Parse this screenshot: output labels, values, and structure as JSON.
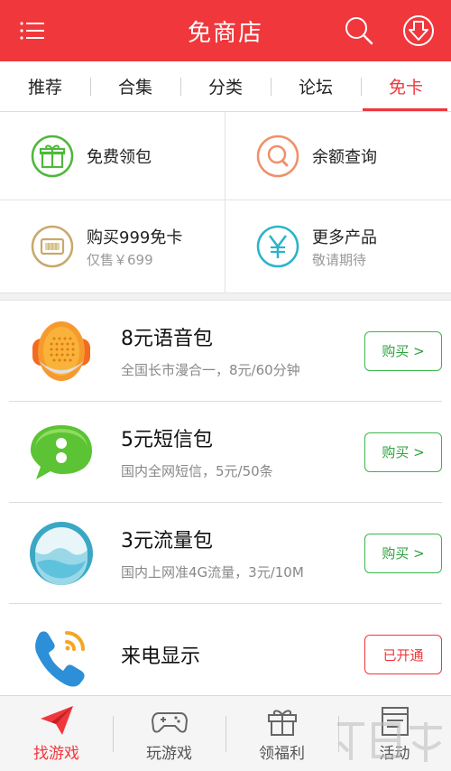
{
  "header": {
    "title": "免商店"
  },
  "tabs": [
    {
      "label": "推荐"
    },
    {
      "label": "合集"
    },
    {
      "label": "分类"
    },
    {
      "label": "论坛"
    },
    {
      "label": "免卡",
      "active": true
    }
  ],
  "grid": [
    {
      "label": "免费领包",
      "icon": "gift-icon",
      "color": "#4fb83b"
    },
    {
      "label": "余额查询",
      "icon": "search-icon",
      "color": "#f0906a"
    },
    {
      "label": "购买999免卡",
      "sub": "仅售￥699",
      "icon": "sim-card-icon",
      "color": "#c9a86a"
    },
    {
      "label": "更多产品",
      "sub": "敬请期待",
      "icon": "yen-icon",
      "color": "#2bb3c9"
    }
  ],
  "packages": [
    {
      "name": "8元语音包",
      "desc": "全国长市漫合一，8元/60分钟",
      "button": "购买 >",
      "icon": "microphone-icon"
    },
    {
      "name": "5元短信包",
      "desc": "国内全网短信，5元/50条",
      "button": "购买 >",
      "icon": "sms-bubble-icon"
    },
    {
      "name": "3元流量包",
      "desc": "国内上网准4G流量，3元/10M",
      "button": "购买 >",
      "icon": "data-wave-icon"
    },
    {
      "name": "来电显示",
      "desc": "",
      "button": "已开通",
      "icon": "phone-call-icon"
    }
  ],
  "bottom_nav": [
    {
      "label": "找游戏",
      "icon": "paper-plane-icon",
      "active": true
    },
    {
      "label": "玩游戏",
      "icon": "gamepad-icon"
    },
    {
      "label": "领福利",
      "icon": "gift-icon"
    },
    {
      "label": "活动",
      "icon": "calendar-icon"
    }
  ],
  "colors": {
    "brand": "#f0373c",
    "buy": "#3bb64a"
  }
}
